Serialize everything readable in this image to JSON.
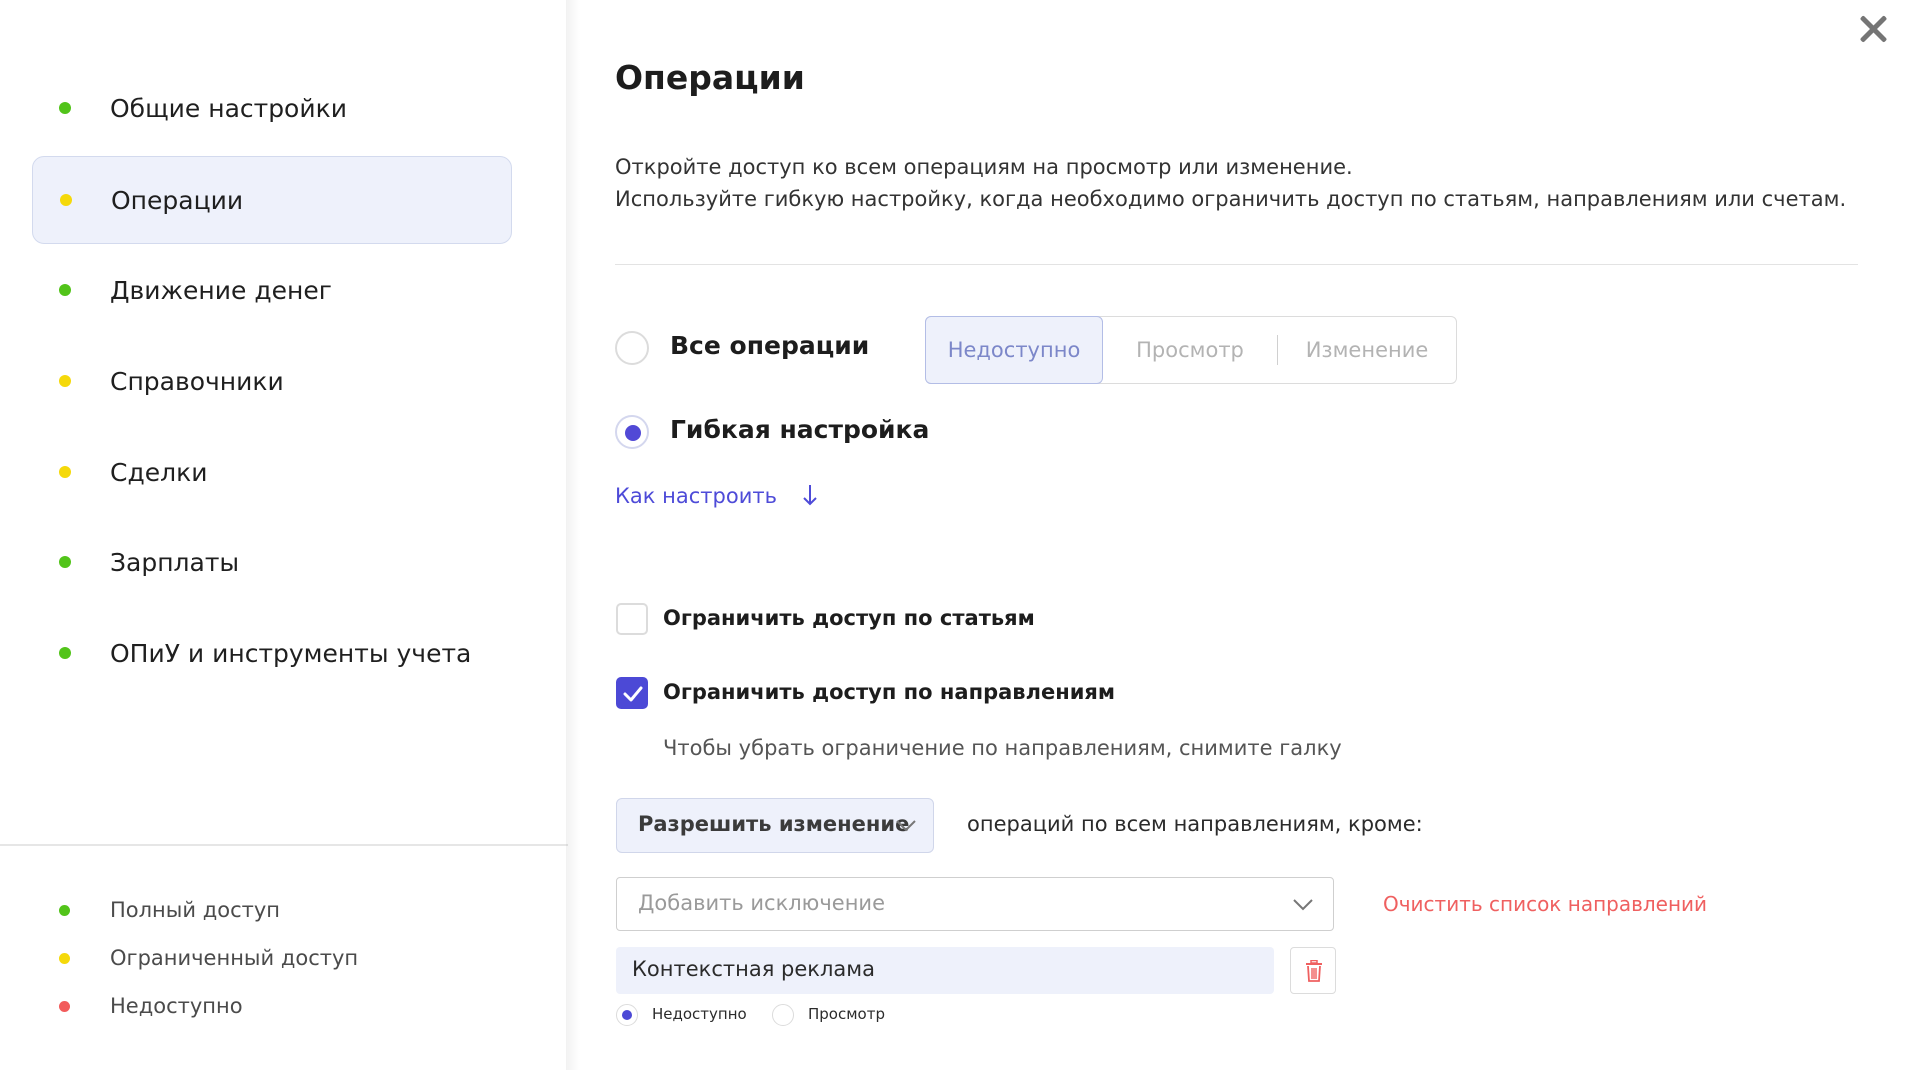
{
  "colors": {
    "full_access": "#52c41a",
    "limited_access": "#f5d90a",
    "no_access": "#f25b5b",
    "accent": "#4c49d6"
  },
  "sidebar": {
    "items": [
      {
        "label": "Общие настройки",
        "status": "full"
      },
      {
        "label": "Операции",
        "status": "limited",
        "active": true
      },
      {
        "label": "Движение денег",
        "status": "full"
      },
      {
        "label": "Справочники",
        "status": "limited"
      },
      {
        "label": "Сделки",
        "status": "limited"
      },
      {
        "label": "Зарплаты",
        "status": "full"
      },
      {
        "label": "ОПиУ и инструменты учета",
        "status": "full"
      }
    ],
    "legend": [
      {
        "label": "Полный доступ",
        "status": "full"
      },
      {
        "label": "Ограниченный доступ",
        "status": "limited"
      },
      {
        "label": "Недоступно",
        "status": "none"
      }
    ]
  },
  "main": {
    "title": "Операции",
    "description": [
      "Откройте доступ ко всем операциям на просмотр или изменение.",
      "Используйте гибкую настройку, когда необходимо ограничить доступ по статьям, направлениям или счетам."
    ],
    "all_operations": {
      "label": "Все операции",
      "checked": false,
      "options": [
        "Недоступно",
        "Просмотр",
        "Изменение"
      ],
      "selected": "Недоступно"
    },
    "flexible": {
      "label": "Гибкая настройка",
      "checked": true
    },
    "how_to_link": "Как настроить",
    "how_to_icon": "arrow-down-icon",
    "restrict_articles": {
      "label": "Ограничить доступ по статьям",
      "checked": false
    },
    "restrict_directions": {
      "label": "Ограничить доступ по направлениям",
      "checked": true
    },
    "hint": "Чтобы убрать ограничение по направлениям, снимите галку",
    "permission_select": "Разрешить изменение",
    "permission_suffix": "операций по всем направлениям, кроме:",
    "exception_placeholder": "Добавить исключение",
    "clear_link": "Очистить список направлений",
    "exceptions": [
      {
        "name": "Контекстная реклама",
        "options": [
          "Недоступно",
          "Просмотр"
        ],
        "selected": "Недоступно"
      }
    ]
  }
}
